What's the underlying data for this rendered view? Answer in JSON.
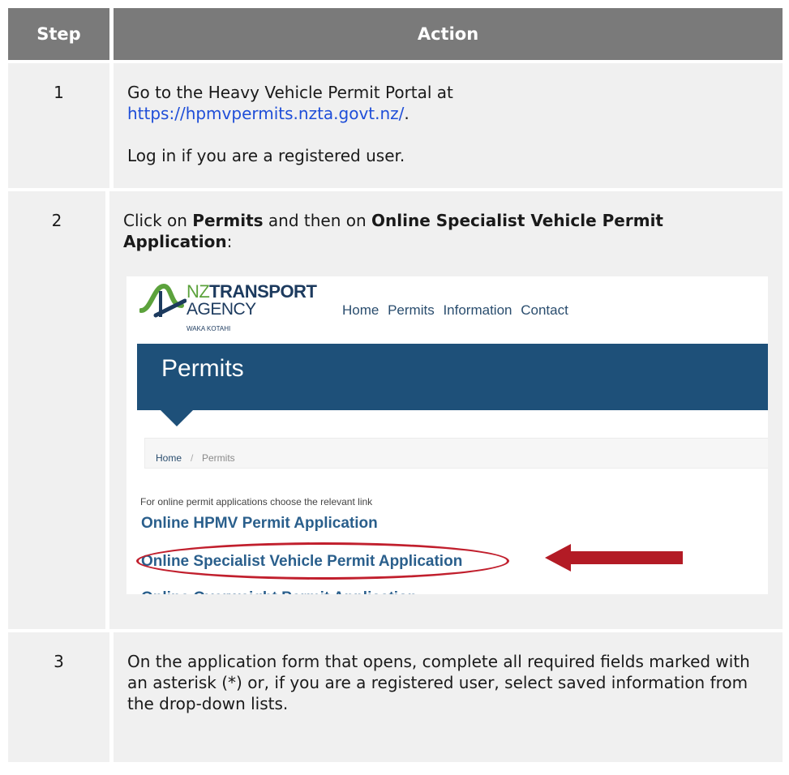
{
  "header": {
    "step": "Step",
    "action": "Action"
  },
  "rows": [
    {
      "num": "1",
      "line1": "Go to the Heavy Vehicle Permit Portal at",
      "link": "https://hpmvpermits.nzta.govt.nz/",
      "link_suffix": ".",
      "line2": "Log in if you are a registered user."
    },
    {
      "num": "2",
      "text_a": "Click on ",
      "bold_a": "Permits",
      "text_b": " and then on ",
      "bold_b": "Online Specialist Vehicle Permit Application",
      "text_c": ":"
    },
    {
      "num": "3",
      "text": "On the application form that opens, complete all required fields marked with an asterisk (*) or, if you are a registered user, select saved information from the drop-down lists."
    }
  ],
  "screenshot": {
    "logo_nz": "NZ",
    "logo_transport": "TRANSPORT",
    "logo_agency": "AGENCY",
    "logo_waka": "WAKA KOTAHI",
    "nav": [
      "Home",
      "Permits",
      "Information",
      "Contact"
    ],
    "banner_title": "Permits",
    "breadcrumb_home": "Home",
    "breadcrumb_sep": "/",
    "breadcrumb_current": "Permits",
    "hint": "For online permit applications choose the relevant link",
    "links": [
      "Online HPMV Permit Application",
      "Online Specialist Vehicle Permit Application",
      "Online Overweight Permit Application"
    ],
    "colors": {
      "banner": "#1e5079",
      "link": "#2a5f8c",
      "highlight": "#c11f2d"
    }
  }
}
